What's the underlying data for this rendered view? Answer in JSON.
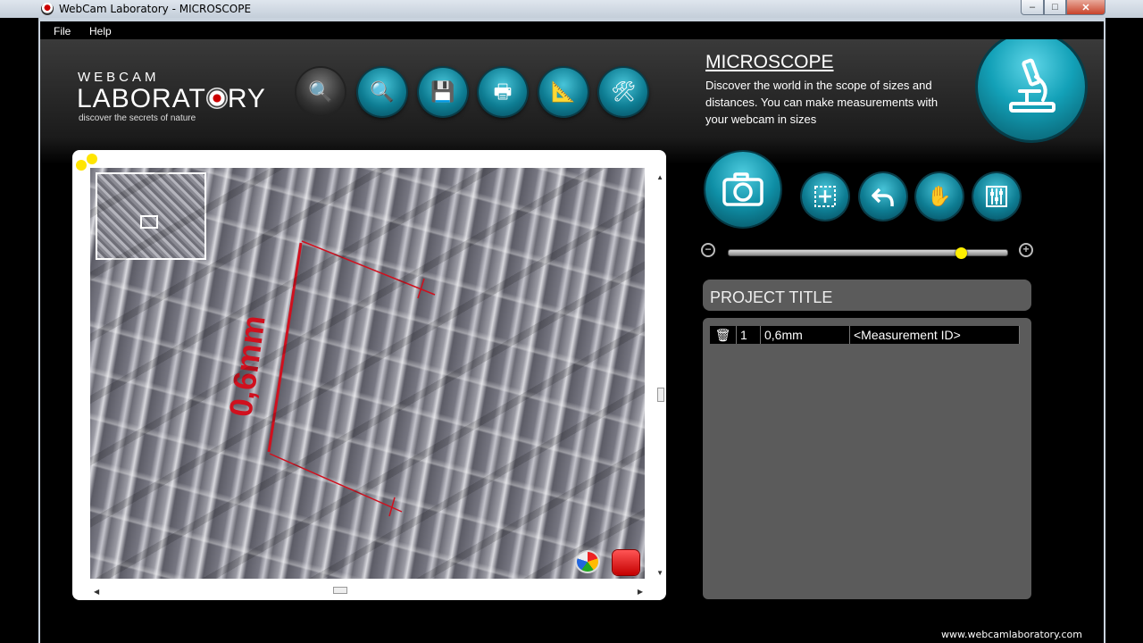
{
  "window": {
    "title": "WebCam Laboratory - MICROSCOPE",
    "minimize": "–",
    "maximize": "□",
    "close": "✕"
  },
  "menu": {
    "file": "File",
    "help": "Help"
  },
  "logo": {
    "top": "WEBCAM",
    "main_before": "LABORAT",
    "main_after": "RY",
    "tagline": "discover the secrets of nature"
  },
  "toolbar": [
    {
      "name": "capture-tool",
      "icon": "magnifier-camera-icon",
      "glyph": "🔍"
    },
    {
      "name": "image-tool",
      "icon": "magnifier-image-icon",
      "glyph": "🔍"
    },
    {
      "name": "save-tool",
      "icon": "floppy-disk-icon",
      "glyph": "💾"
    },
    {
      "name": "print-tool",
      "icon": "printer-icon",
      "glyph": "🖶"
    },
    {
      "name": "measure-tool",
      "icon": "ruler-triangle-icon",
      "glyph": "📐"
    },
    {
      "name": "settings-tool",
      "icon": "tools-icon",
      "glyph": "🛠"
    }
  ],
  "header": {
    "title": "MICROSCOPE",
    "description": "Discover the world in the scope of sizes and distances. You can make measurements with your webcam in sizes"
  },
  "measurement_overlay": {
    "label": "0,6mm"
  },
  "zoom": {
    "level": 0.83
  },
  "project": {
    "title": "PROJECT TITLE",
    "rows": [
      {
        "index": "1",
        "value": "0,6mm",
        "id": "<Measurement ID>"
      }
    ]
  },
  "footer": {
    "url": "www.webcamlaboratory.com"
  },
  "colors": {
    "accent": "#0f8fa6",
    "measure": "#d0101e",
    "slider": "#ffee00"
  }
}
